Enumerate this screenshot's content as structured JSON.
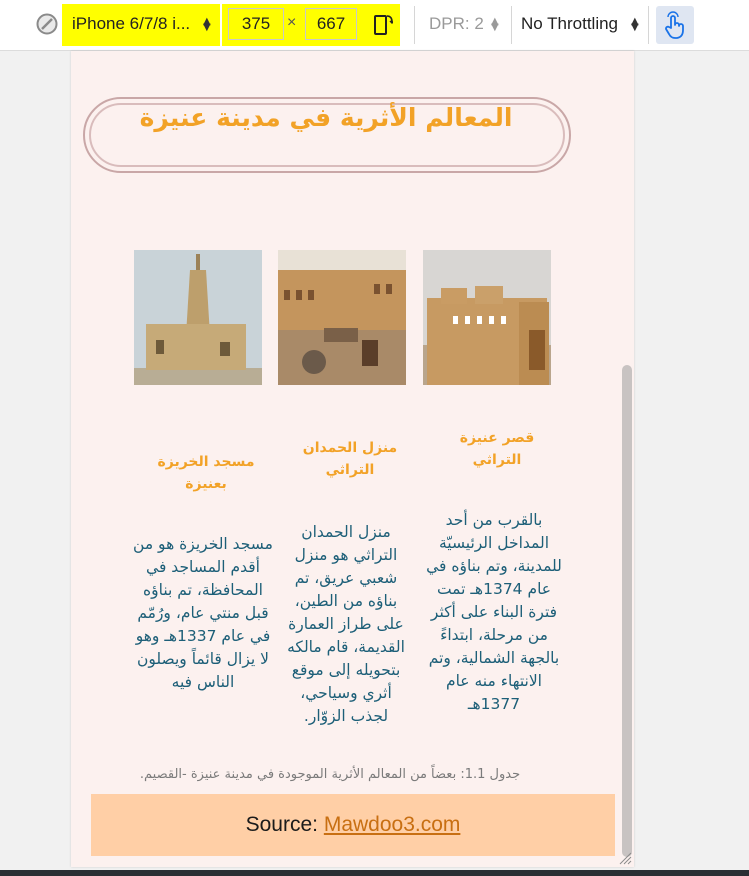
{
  "devtools": {
    "device": "iPhone 6/7/8 i...",
    "width": "375",
    "times": "×",
    "height": "667",
    "dpr": "DPR: 2",
    "throttling": "No Throttling",
    "highlight_color": "#ffff00"
  },
  "page": {
    "title": "المعالم الأثرية في مدينة عنيزة",
    "landmarks": [
      {
        "name": "قصر عنيزة التراثي",
        "description": "بالقرب من أحد المداخل الرئيسيّة للمدينة، وتم بناؤه في عام 1374هـ تمت فترة البناء على أكثر من مرحلة، ابتداءً بالجهة الشمالية، وتم الانتهاء منه عام 1377هـ"
      },
      {
        "name": "منزل الحمدان التراثي",
        "description": "منزل الحمدان التراثي هو منزل شعبي عريق، تم بناؤه من الطين، على طراز العمارة القديمة، قام مالكه بتحويله إلى موقع أثري وسياحي، لجذب الزوّار."
      },
      {
        "name": "مسجد الخريزة بعنيزة",
        "description": "مسجد الخريزة هو من أقدم المساجد في المحافظة، تم بناؤه قبل منتي عام، ورُمّم في عام 1337هـ وهو لا يزال قائماً ويصلون الناس فيه"
      }
    ],
    "caption": "جدول 1.1: بعضاً من المعالم الأثرية الموجودة في مدينة عنيزة -القصيم.",
    "source_label": "Source:",
    "source_link": "Mawdoo3.com",
    "accent_color": "#f2a227",
    "text_color": "#1d5f78",
    "source_bg": "#ffcfa6"
  },
  "icons": [
    "compass-icon",
    "rotate-icon",
    "touch-icon",
    "resize-grip-icon"
  ]
}
